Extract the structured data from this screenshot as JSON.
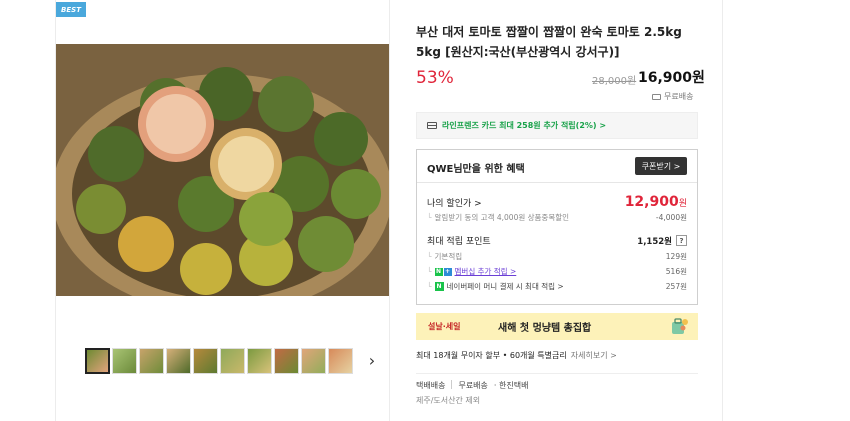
{
  "badge": "BEST",
  "product": {
    "title": "부산 대저 토마토 짭짤이 짭짤이 완숙 토마토 2.5kg 5kg [원산지:국산(부산광역시 강서구)]",
    "discount": "53%",
    "original_price": "28,000원",
    "price": "16,900원",
    "shipping": "무료배송"
  },
  "card_promo": "라인프렌즈 카드 최대 258원 추가 적립(2%) >",
  "benefit": {
    "heading": "QWE님만을 위한 혜택",
    "coupon_button": "쿠폰받기 >",
    "my_price_label": "나의 할인가 >",
    "my_price_value": "12,900",
    "my_price_unit": "원",
    "alert_discount_label": "알림받기 동의 고객 4,000원 상품중복할인",
    "alert_discount_value": "-4,000원",
    "points_label": "최대 적립 포인트",
    "points_value": "1,152원",
    "points_help": "?",
    "basic_label": "기본적립",
    "basic_value": "129원",
    "membership_label": "멤버십 추가 적립 >",
    "membership_value": "516원",
    "npay_label": "네이버페이 머니 결제 시 최대 적립 >",
    "npay_value": "257원"
  },
  "banner": {
    "tag": "설날·세일",
    "text": "새해 첫 멍냥템 총집합"
  },
  "installment": {
    "text": "최대 18개월 무이자 할부 • 60개월 특별금리",
    "more": "자세히보기 >"
  },
  "delivery": {
    "type": "택배배송",
    "fee": "무료배송",
    "carrier": "· 한진택배",
    "note": "제주/도서산간 제외"
  },
  "colors": {
    "accent_red": "#e0253a",
    "naver_green": "#19a24a",
    "badge_blue": "#4aa8dc",
    "banner_yellow": "#fdf2b9"
  }
}
